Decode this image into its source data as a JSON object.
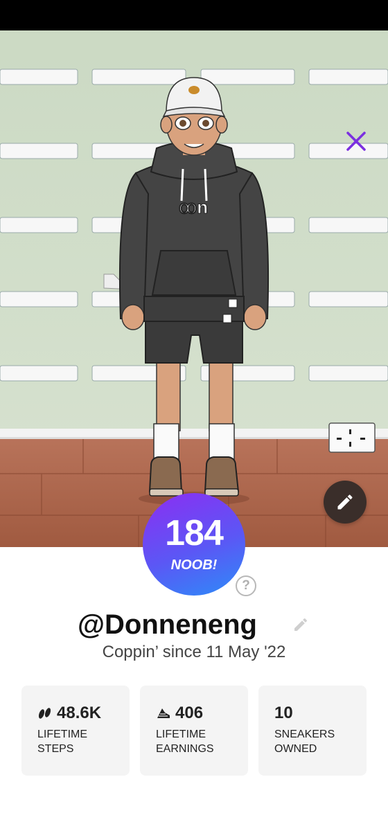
{
  "profile": {
    "level_number": "184",
    "level_title": "NOOB!",
    "username": "@Donneneng",
    "since_text": "Coppin’ since 11 May '22"
  },
  "hoodie_logo": "ꝏn",
  "stats": [
    {
      "icon": "steps-icon",
      "value": "48.6K",
      "label_line1": "LIFETIME",
      "label_line2": "STEPS"
    },
    {
      "icon": "sneaker-currency-icon",
      "value": "406",
      "label_line1": "LIFETIME",
      "label_line2": "EARNINGS"
    },
    {
      "icon": "",
      "value": "10",
      "label_line1": "SNEAKERS",
      "label_line2": "OWNED"
    }
  ],
  "colors": {
    "wall": "#cfdcc7",
    "floor": "#a8654a",
    "accent_close": "#7b2fe0",
    "badge_start": "#8c2ef2",
    "badge_end": "#2d8cf8"
  }
}
